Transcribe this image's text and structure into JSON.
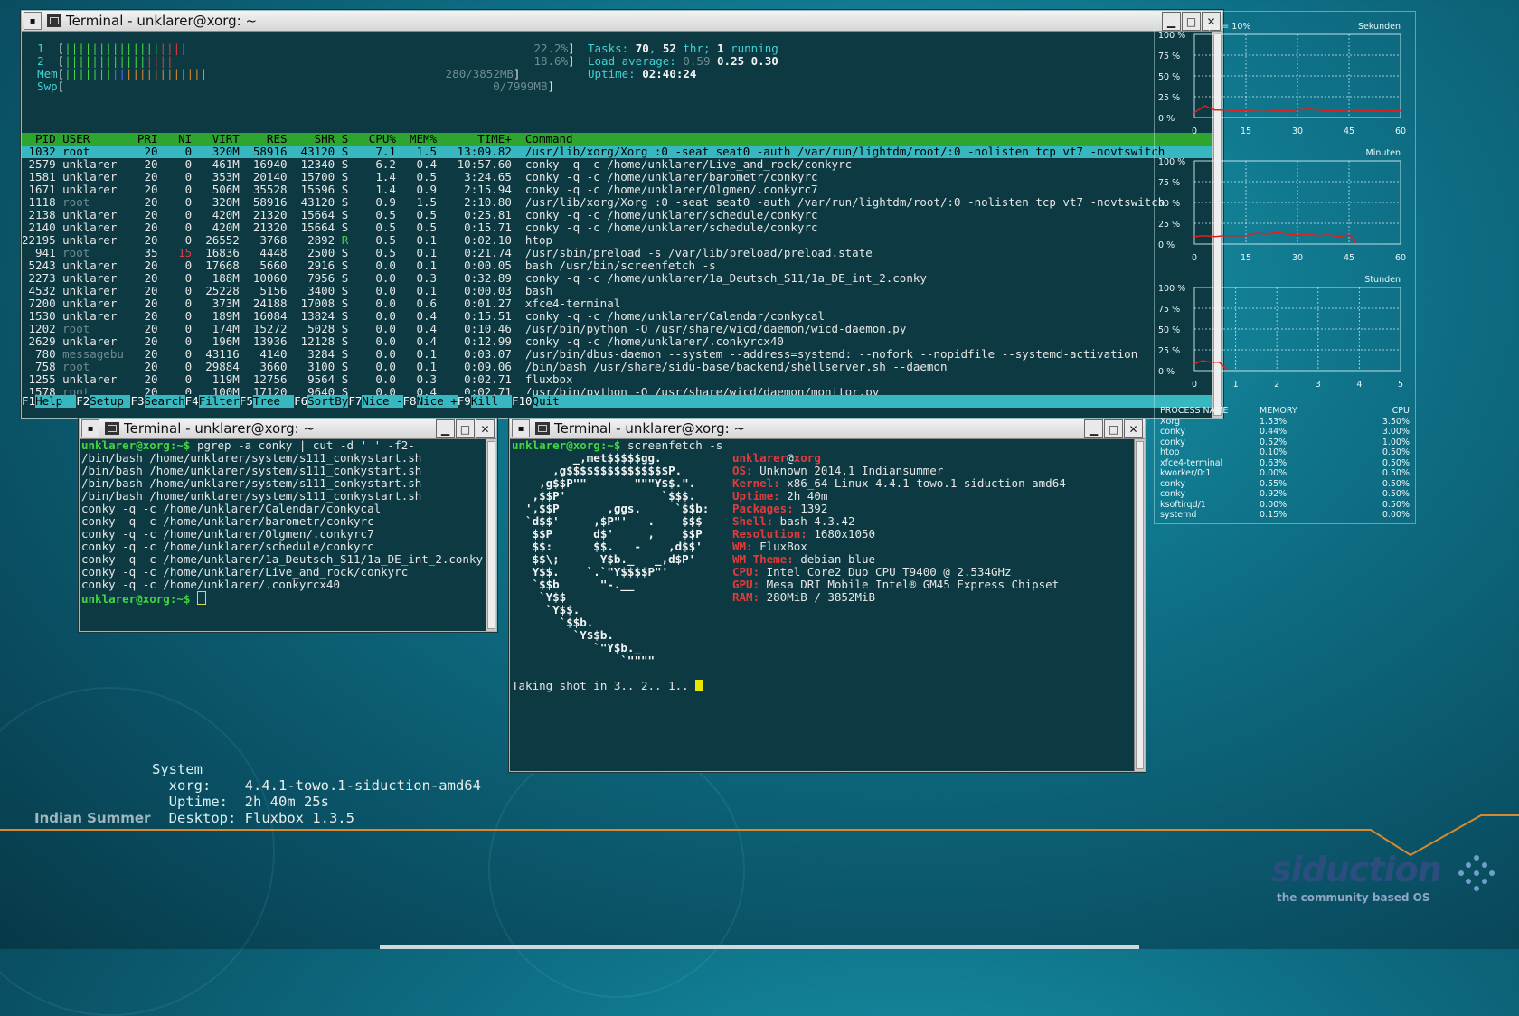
{
  "desktop": {
    "theme_label": "Indian Summer",
    "brand_name": "siduction",
    "brand_tagline": "the community based OS",
    "sysinfo": {
      "heading": "System",
      "rows": [
        {
          "label": "xorg:",
          "value": "4.4.1-towo.1-siduction-amd64"
        },
        {
          "label": "Uptime:",
          "value": "2h 40m 25s"
        },
        {
          "label": "Desktop:",
          "value": "Fluxbox 1.3.5"
        }
      ]
    },
    "colors": {
      "background": "#0e6f85",
      "accent_orange": "#d88a2c",
      "brand_blue": "#2b4e7e"
    }
  },
  "windows": {
    "htop": {
      "title": "Terminal - unklarer@xorg: ~"
    },
    "pgrep": {
      "title": "Terminal - unklarer@xorg: ~"
    },
    "screenfetch": {
      "title": "Terminal - unklarer@xorg: ~"
    }
  },
  "htop": {
    "cpu1_label": "1",
    "cpu1_pct": "22.2%",
    "cpu2_label": "2",
    "cpu2_pct": "18.6%",
    "mem_label": "Mem",
    "mem_value": "280/3852MB",
    "swp_label": "Swp",
    "swp_value": "0/7999MB",
    "tasks_label": "Tasks:",
    "tasks_count": "70",
    "threads": "52",
    "thr_label": "thr;",
    "running": "1",
    "running_label": "running",
    "load_label": "Load average:",
    "load1": "0.59",
    "load5": "0.25",
    "load15": "0.30",
    "uptime_label": "Uptime:",
    "uptime_value": "02:40:24",
    "columns": [
      "PID",
      "USER",
      "PRI",
      "NI",
      "VIRT",
      "RES",
      "SHR",
      "S",
      "CPU%",
      "MEM%",
      "TIME+",
      "Command"
    ],
    "processes": [
      [
        "1032",
        "root",
        "20",
        "0",
        "320M",
        "58916",
        "43120",
        "S",
        "7.1",
        "1.5",
        "13:09.82",
        "/usr/lib/xorg/Xorg :0 -seat seat0 -auth /var/run/lightdm/root/:0 -nolisten tcp vt7 -novtswitch"
      ],
      [
        "2579",
        "unklarer",
        "20",
        "0",
        "461M",
        "16940",
        "12340",
        "S",
        "6.2",
        "0.4",
        "10:57.60",
        "conky -q -c /home/unklarer/Live_and_rock/conkyrc"
      ],
      [
        "1581",
        "unklarer",
        "20",
        "0",
        "353M",
        "20140",
        "15700",
        "S",
        "1.4",
        "0.5",
        "3:24.65",
        "conky -q -c /home/unklarer/barometr/conkyrc"
      ],
      [
        "1671",
        "unklarer",
        "20",
        "0",
        "506M",
        "35528",
        "15596",
        "S",
        "1.4",
        "0.9",
        "2:15.94",
        "conky -q -c /home/unklarer/Olgmen/.conkyrc7"
      ],
      [
        "1118",
        "root",
        "20",
        "0",
        "320M",
        "58916",
        "43120",
        "S",
        "0.9",
        "1.5",
        "2:10.80",
        "/usr/lib/xorg/Xorg :0 -seat seat0 -auth /var/run/lightdm/root/:0 -nolisten tcp vt7 -novtswitch"
      ],
      [
        "2138",
        "unklarer",
        "20",
        "0",
        "420M",
        "21320",
        "15664",
        "S",
        "0.5",
        "0.5",
        "0:25.81",
        "conky -q -c /home/unklarer/schedule/conkyrc"
      ],
      [
        "2140",
        "unklarer",
        "20",
        "0",
        "420M",
        "21320",
        "15664",
        "S",
        "0.5",
        "0.5",
        "0:15.71",
        "conky -q -c /home/unklarer/schedule/conkyrc"
      ],
      [
        "22195",
        "unklarer",
        "20",
        "0",
        "26552",
        "3768",
        "2892",
        "R",
        "0.5",
        "0.1",
        "0:02.10",
        "htop"
      ],
      [
        "941",
        "root",
        "35",
        "15",
        "16836",
        "4448",
        "2500",
        "S",
        "0.5",
        "0.1",
        "0:21.74",
        "/usr/sbin/preload -s /var/lib/preload/preload.state"
      ],
      [
        "5243",
        "unklarer",
        "20",
        "0",
        "17668",
        "5660",
        "2916",
        "S",
        "0.0",
        "0.1",
        "0:00.05",
        "bash /usr/bin/screenfetch -s"
      ],
      [
        "2273",
        "unklarer",
        "20",
        "0",
        "188M",
        "10060",
        "7956",
        "S",
        "0.0",
        "0.3",
        "0:32.89",
        "conky -q -c /home/unklarer/1a_Deutsch_S11/1a_DE_int_2.conky"
      ],
      [
        "4532",
        "unklarer",
        "20",
        "0",
        "25228",
        "5156",
        "3400",
        "S",
        "0.0",
        "0.1",
        "0:00.03",
        "bash"
      ],
      [
        "7200",
        "unklarer",
        "20",
        "0",
        "373M",
        "24188",
        "17008",
        "S",
        "0.0",
        "0.6",
        "0:01.27",
        "xfce4-terminal"
      ],
      [
        "1530",
        "unklarer",
        "20",
        "0",
        "189M",
        "16084",
        "13824",
        "S",
        "0.0",
        "0.4",
        "0:15.51",
        "conky -q -c /home/unklarer/Calendar/conkycal"
      ],
      [
        "1202",
        "root",
        "20",
        "0",
        "174M",
        "15272",
        "5028",
        "S",
        "0.0",
        "0.4",
        "0:10.46",
        "/usr/bin/python -O /usr/share/wicd/daemon/wicd-daemon.py"
      ],
      [
        "2629",
        "unklarer",
        "20",
        "0",
        "196M",
        "13936",
        "12128",
        "S",
        "0.0",
        "0.4",
        "0:12.99",
        "conky -q -c /home/unklarer/.conkyrcx40"
      ],
      [
        "780",
        "messagebu",
        "20",
        "0",
        "43116",
        "4140",
        "3284",
        "S",
        "0.0",
        "0.1",
        "0:03.07",
        "/usr/bin/dbus-daemon --system --address=systemd: --nofork --nopidfile --systemd-activation"
      ],
      [
        "758",
        "root",
        "20",
        "0",
        "29884",
        "3660",
        "3100",
        "S",
        "0.0",
        "0.1",
        "0:09.06",
        "/bin/bash /usr/share/sidu-base/backend/shellserver.sh --daemon"
      ],
      [
        "1255",
        "unklarer",
        "20",
        "0",
        "119M",
        "12756",
        "9564",
        "S",
        "0.0",
        "0.3",
        "0:02.71",
        "fluxbox"
      ],
      [
        "1578",
        "root",
        "20",
        "0",
        "100M",
        "17120",
        "9640",
        "S",
        "0.0",
        "0.4",
        "0:02.71",
        "/usr/bin/python -O /usr/share/wicd/daemon/monitor.py"
      ]
    ],
    "fkeys": [
      {
        "key": "F1",
        "label": "Help"
      },
      {
        "key": "F2",
        "label": "Setup"
      },
      {
        "key": "F3",
        "label": "Search"
      },
      {
        "key": "F4",
        "label": "Filter"
      },
      {
        "key": "F5",
        "label": "Tree"
      },
      {
        "key": "F6",
        "label": "SortBy"
      },
      {
        "key": "F7",
        "label": "Nice -"
      },
      {
        "key": "F8",
        "label": "Nice +"
      },
      {
        "key": "F9",
        "label": "Kill"
      },
      {
        "key": "F10",
        "label": "Quit"
      }
    ]
  },
  "pgrep": {
    "prompt": "unklarer@xorg:~$",
    "command": " pgrep -a conky | cut -d ' ' -f2-",
    "output": [
      "/bin/bash /home/unklarer/system/s111_conkystart.sh",
      "/bin/bash /home/unklarer/system/s111_conkystart.sh",
      "/bin/bash /home/unklarer/system/s111_conkystart.sh",
      "/bin/bash /home/unklarer/system/s111_conkystart.sh",
      "conky -q -c /home/unklarer/Calendar/conkycal",
      "conky -q -c /home/unklarer/barometr/conkyrc",
      "conky -q -c /home/unklarer/Olgmen/.conkyrc7",
      "conky -q -c /home/unklarer/schedule/conkyrc",
      "conky -q -c /home/unklarer/1a_Deutsch_S11/1a_DE_int_2.conky",
      "conky -q -c /home/unklarer/Live_and_rock/conkyrc",
      "conky -q -c /home/unklarer/.conkyrcx40"
    ],
    "prompt2": "unklarer@xorg:~$"
  },
  "screenfetch": {
    "prompt": "unklarer@xorg:~$",
    "command": " screenfetch -s",
    "logo": [
      "         _,met$$$$$gg.",
      "      ,g$$$$$$$$$$$$$$$P.",
      "    ,g$$P\"\"       \"\"\"Y$$.\".",
      "   ,$$P'              `$$$.",
      "  ',$$P       ,ggs.     `$$b:",
      "  `d$$'     ,$P\"'   .    $$$",
      "   $$P      d$'     ,    $$P",
      "   $$:      $$.   -    ,d$$'",
      "   $$\\;      Y$b._   _,d$P'",
      "   Y$$.    `.`\"Y$$$$P\"'",
      "   `$$b      \"-.__",
      "    `Y$$",
      "     `Y$$.",
      "       `$$b.",
      "         `Y$$b.",
      "            `\"Y$b._",
      "                `\"\"\"\""
    ],
    "user": "unklarer",
    "at": "@",
    "host": "xorg",
    "info": [
      {
        "k": "OS:",
        "v": "Unknown 2014.1 Indiansummer"
      },
      {
        "k": "Kernel:",
        "v": "x86_64 Linux 4.4.1-towo.1-siduction-amd64"
      },
      {
        "k": "Uptime:",
        "v": "2h 40m"
      },
      {
        "k": "Packages:",
        "v": "1392"
      },
      {
        "k": "Shell:",
        "v": "bash 4.3.42"
      },
      {
        "k": "Resolution:",
        "v": "1680x1050"
      },
      {
        "k": "WM:",
        "v": "FluxBox"
      },
      {
        "k": "WM Theme:",
        "v": "debian-blue"
      },
      {
        "k": "CPU:",
        "v": "Intel Core2 Duo CPU T9400 @ 2.534GHz"
      },
      {
        "k": "GPU:",
        "v": "Mesa DRI Mobile Intel® GM45 Express Chipset"
      },
      {
        "k": "RAM:",
        "v": "280MiB / 3852MiB"
      }
    ],
    "footer": "Taking shot in 3.. 2.. 1.. "
  },
  "chart_data": [
    {
      "type": "line",
      "title": "Sekunden",
      "subtitle": "cpu = 10%",
      "ylim": [
        0,
        100
      ],
      "yticks": [
        "100 %",
        "75 %",
        "50 %",
        "25 %",
        "0 %"
      ],
      "xlim": [
        0,
        60
      ],
      "xticks": [
        "0",
        "15",
        "30",
        "45",
        "60"
      ],
      "x": [
        0,
        3,
        6,
        9,
        12,
        15,
        18,
        21,
        24,
        27,
        30,
        33,
        36,
        39,
        42,
        45,
        48,
        51,
        54,
        57,
        60
      ],
      "values": [
        6,
        14,
        9,
        9,
        8,
        8,
        9,
        9,
        8,
        8,
        9,
        10,
        9,
        8,
        8,
        9,
        8,
        8,
        8,
        8,
        8
      ]
    },
    {
      "type": "line",
      "title": "Minuten",
      "ylim": [
        0,
        100
      ],
      "yticks": [
        "100 %",
        "75 %",
        "50 %",
        "25 %",
        "0 %"
      ],
      "xlim": [
        0,
        60
      ],
      "xticks": [
        "0",
        "15",
        "30",
        "45",
        "60"
      ],
      "x": [
        0,
        3,
        6,
        9,
        12,
        15,
        18,
        21,
        24,
        27,
        30,
        33,
        36,
        39,
        42,
        45,
        46,
        47
      ],
      "values": [
        9,
        10,
        9,
        10,
        10,
        10,
        13,
        12,
        14,
        12,
        11,
        12,
        10,
        11,
        9,
        11,
        8,
        1
      ]
    },
    {
      "type": "line",
      "title": "Stunden",
      "ylim": [
        0,
        100
      ],
      "yticks": [
        "100 %",
        "75 %",
        "50 %",
        "25 %",
        "0 %"
      ],
      "xlim": [
        0,
        5
      ],
      "xticks": [
        "0",
        "1",
        "2",
        "3",
        "4",
        "5"
      ],
      "x": [
        0,
        0.2,
        0.4,
        0.6,
        0.8
      ],
      "values": [
        8,
        12,
        10,
        10,
        1
      ]
    }
  ],
  "process_table": {
    "headers": [
      "PROCESS NAME",
      "MEMORY",
      "CPU"
    ],
    "rows": [
      [
        "Xorg",
        "1.53%",
        "3.50%"
      ],
      [
        "conky",
        "0.44%",
        "3.00%"
      ],
      [
        "conky",
        "0.52%",
        "1.00%"
      ],
      [
        "htop",
        "0.10%",
        "0.50%"
      ],
      [
        "xfce4-terminal",
        "0.63%",
        "0.50%"
      ],
      [
        "kworker/0:1",
        "0.00%",
        "0.50%"
      ],
      [
        "conky",
        "0.55%",
        "0.50%"
      ],
      [
        "conky",
        "0.92%",
        "0.50%"
      ],
      [
        "ksoftirqd/1",
        "0.00%",
        "0.50%"
      ],
      [
        "systemd",
        "0.15%",
        "0.00%"
      ]
    ]
  }
}
